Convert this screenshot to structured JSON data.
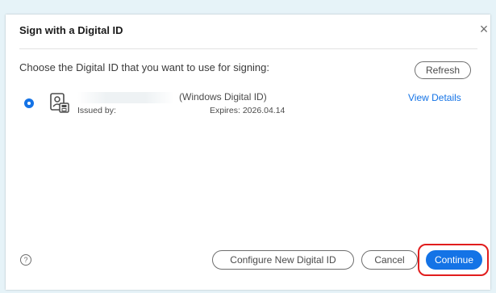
{
  "dialog": {
    "title": "Sign with a Digital ID",
    "close_glyph": "×",
    "prompt": "Choose the Digital ID that you want to use for signing:",
    "refresh_label": "Refresh"
  },
  "digital_id": {
    "type": "(Windows Digital ID)",
    "issued_by_label": "Issued by:",
    "expires": "Expires: 2026.04.14",
    "view_details_label": "View Details",
    "icon": "certificate-card-icon",
    "selected": true
  },
  "footer": {
    "help_glyph": "?",
    "configure_label": "Configure New Digital ID",
    "cancel_label": "Cancel",
    "continue_label": "Continue"
  },
  "colors": {
    "accent": "#1473e6",
    "highlight": "#e11d1d",
    "backdrop": "#e6f3f8"
  }
}
